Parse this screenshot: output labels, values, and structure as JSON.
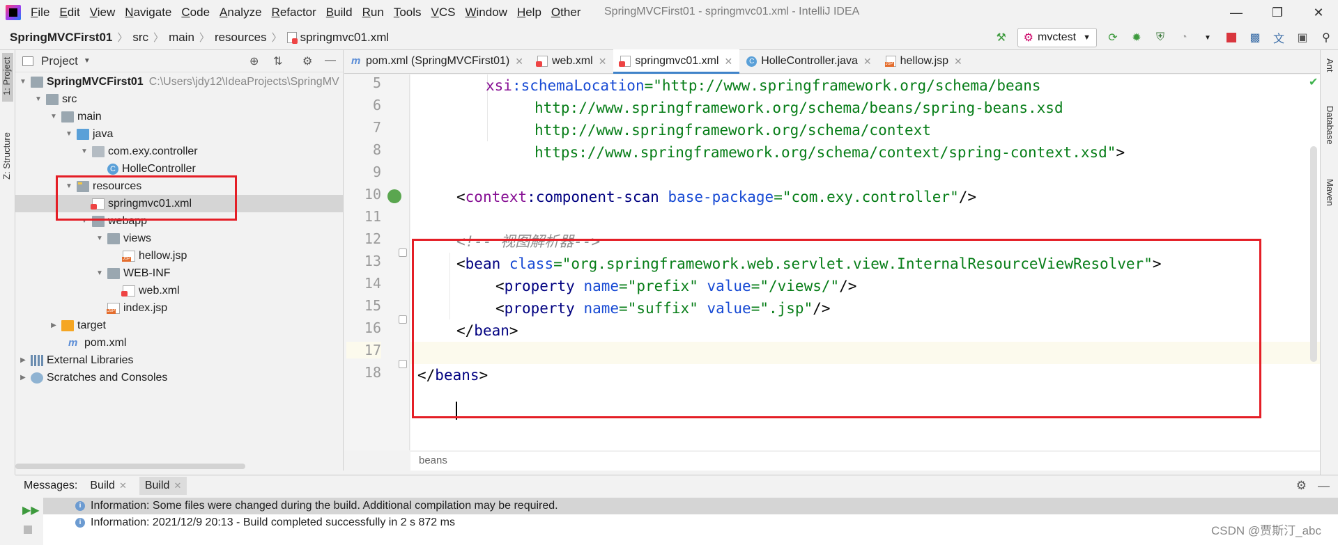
{
  "app": {
    "window_title": "SpringMVCFirst01 - springmvc01.xml - IntelliJ IDEA",
    "menu": [
      "File",
      "Edit",
      "View",
      "Navigate",
      "Code",
      "Analyze",
      "Refactor",
      "Build",
      "Run",
      "Tools",
      "VCS",
      "Window",
      "Help",
      "Other"
    ]
  },
  "navbar": {
    "breadcrumbs": [
      "SpringMVCFirst01",
      "src",
      "main",
      "resources",
      "springmvc01.xml"
    ],
    "run_config": "mvctest"
  },
  "left_strip": {
    "tabs": [
      "1: Project",
      "Z: Structure"
    ]
  },
  "project": {
    "title": "Project",
    "tree": [
      {
        "label": "SpringMVCFirst01",
        "path": "C:\\Users\\jdy12\\IdeaProjects\\SpringMV"
      },
      {
        "label": "src"
      },
      {
        "label": "main"
      },
      {
        "label": "java"
      },
      {
        "label": "com.exy.controller"
      },
      {
        "label": "HolleController"
      },
      {
        "label": "resources"
      },
      {
        "label": "springmvc01.xml"
      },
      {
        "label": "webapp"
      },
      {
        "label": "views"
      },
      {
        "label": "hellow.jsp"
      },
      {
        "label": "WEB-INF"
      },
      {
        "label": "web.xml"
      },
      {
        "label": "index.jsp"
      },
      {
        "label": "target"
      },
      {
        "label": "pom.xml"
      },
      {
        "label": "External Libraries"
      },
      {
        "label": "Scratches and Consoles"
      }
    ]
  },
  "editor": {
    "tabs": [
      "pom.xml (SpringMVCFirst01)",
      "web.xml",
      "springmvc01.xml",
      "HolleController.java",
      "hellow.jsp"
    ],
    "active_tab": "springmvc01.xml",
    "line_numbers": [
      "5",
      "6",
      "7",
      "8",
      "9",
      "10",
      "11",
      "12",
      "13",
      "14",
      "15",
      "16",
      "17",
      "18"
    ],
    "code": {
      "l5_ns": "xsi",
      "l5_attr": ":schemaLocation",
      "l5_eq": "=",
      "l5_val": "\"http://www.springframework.org/schema/beans",
      "l6_val": "http://www.springframework.org/schema/beans/spring-beans.xsd",
      "l7_val": "http://www.springframework.org/schema/context",
      "l8_val": "https://www.springframework.org/schema/context/spring-context.xsd\"",
      "l8_close": ">",
      "l10_open": "<",
      "l10_ns": "context",
      "l10_tag": ":component-scan",
      "l10_attr": " base-package",
      "l10_eq": "=",
      "l10_val": "\"com.exy.controller\"",
      "l10_close": "/>",
      "l12_comment": "<!-- 视图解析器-->",
      "l13_open": "<",
      "l13_tag": "bean",
      "l13_attr": " class",
      "l13_eq": "=",
      "l13_val": "\"org.springframework.web.servlet.view.InternalResourceViewResolver\"",
      "l13_close": ">",
      "l14_open": "<",
      "l14_tag": "property",
      "l14_attr1": " name",
      "l14_eq1": "=",
      "l14_val1": "\"prefix\"",
      "l14_attr2": " value",
      "l14_eq2": "=",
      "l14_val2": "\"/views/\"",
      "l14_close": "/>",
      "l15_open": "<",
      "l15_tag": "property",
      "l15_attr1": " name",
      "l15_eq1": "=",
      "l15_val1": "\"suffix\"",
      "l15_attr2": " value",
      "l15_eq2": "=",
      "l15_val2": "\".jsp\"",
      "l15_close": "/>",
      "l16_open": "</",
      "l16_tag": "bean",
      "l16_close": ">",
      "l18_open": "</",
      "l18_tag": "beans",
      "l18_close": ">"
    },
    "footer_breadcrumb": "beans"
  },
  "right_strip": {
    "tabs": [
      "Ant",
      "Database",
      "Maven"
    ]
  },
  "bottom": {
    "tabs": [
      "Messages:",
      "Build",
      "Build"
    ],
    "messages": [
      "Information: Some files were changed during the build. Additional compilation may be required.",
      "Information: 2021/12/9 20:13 - Build completed successfully in 2 s 872 ms"
    ]
  },
  "watermark": "CSDN @贾斯汀_abc",
  "colors": {
    "accent": "#4083c9",
    "annotation_red": "#e41e26",
    "xml_tag": "#000080",
    "xml_attr": "#174ad4",
    "xml_value": "#067d17",
    "xml_namespace": "#871094",
    "comment": "#8c8c8c"
  }
}
